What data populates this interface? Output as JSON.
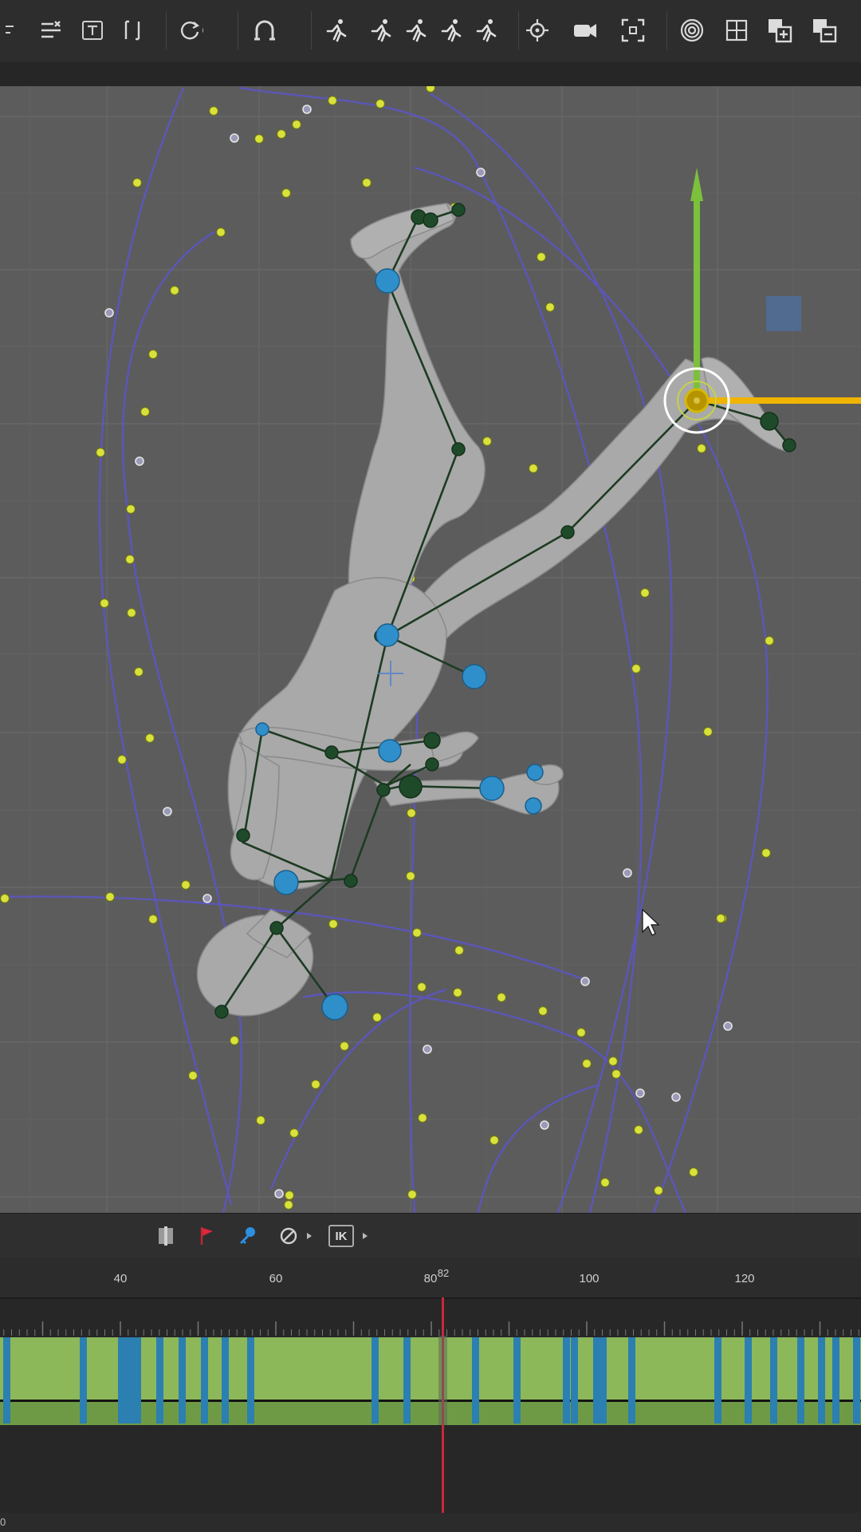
{
  "toolbar": {
    "buttons": [
      "move-icon",
      "curve-filter-icon",
      "text-icon",
      "bracket-icon",
      "rotate-icon",
      "magnet-icon",
      "run-pose-1-icon",
      "run-pose-2-icon",
      "run-pose-3-icon",
      "run-pose-4-icon",
      "run-pose-5-icon",
      "target-icon",
      "camera-icon",
      "frame-icon",
      "spiral-icon",
      "grid-icon",
      "add-layer-icon",
      "remove-layer-icon"
    ]
  },
  "anim_toolbar": {
    "ik_label": "IK"
  },
  "timeline": {
    "ticks": [
      {
        "label": "40",
        "frame": 40
      },
      {
        "label": "60",
        "frame": 60
      },
      {
        "label": "80",
        "frame": 80
      },
      {
        "label": "100",
        "frame": 100
      },
      {
        "label": "120",
        "frame": 120
      }
    ],
    "current_frame_label": "82",
    "current_frame": 82
  },
  "status": {
    "left_text": "0"
  },
  "colors": {
    "accent_green": "#8db85a",
    "key_blue": "#2b7fb1",
    "playhead_red": "#c8283a",
    "gizmo_y": "#7cc03c",
    "gizmo_x": "#f0b400"
  }
}
